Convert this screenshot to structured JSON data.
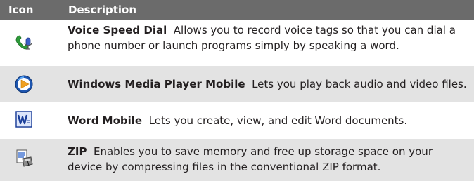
{
  "header": {
    "icon_col": "Icon",
    "description_col": "Description"
  },
  "rows": [
    {
      "icon": "voice-speed-dial-icon",
      "name": "Voice Speed Dial",
      "text": "Allows you to record voice tags so that you can dial a phone number or launch programs simply by speaking a word."
    },
    {
      "icon": "windows-media-player-icon",
      "name": "Windows Media Player Mobile",
      "text": "Lets you play back audio and video files."
    },
    {
      "icon": "word-mobile-icon",
      "name": "Word Mobile",
      "text": "Lets you create, view, and edit Word documents."
    },
    {
      "icon": "zip-icon",
      "name": "ZIP",
      "text": "Enables you to save memory and free up storage space on your device by compressing files in the conventional ZIP format."
    }
  ],
  "colors": {
    "header_bg": "#6b6b6b",
    "row_shade": "#e3e3e3"
  }
}
